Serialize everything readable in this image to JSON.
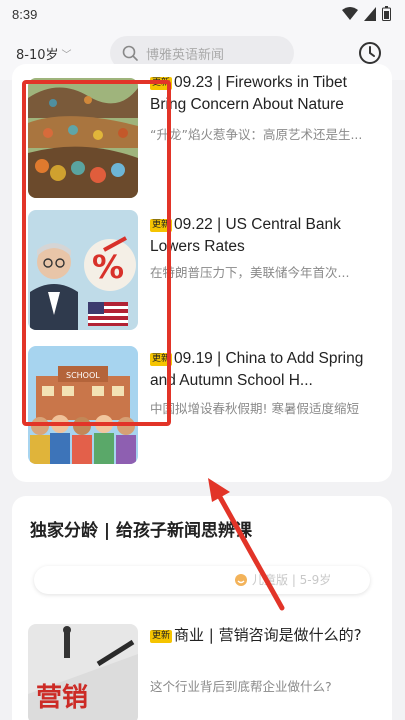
{
  "status_bar": {
    "time": "8:39"
  },
  "header": {
    "age_filter": "8-10岁",
    "search_placeholder": "博雅英语新闻"
  },
  "articles": [
    {
      "tag": "更新",
      "title": "09.23 | Fireworks in Tibet Bring Concern About Nature",
      "subtitle": "“升龙”焰火惹争议：高原艺术还是生..."
    },
    {
      "tag": "更新",
      "title": "09.22 | US Central Bank Lowers Rates",
      "subtitle": "在特朗普压力下，美联储今年首次..."
    },
    {
      "tag": "更新",
      "title": "09.19 | China to Add Spring and Autumn School H...",
      "subtitle": "中国拟增设春秋假期! 寒暑假适度缩短"
    }
  ],
  "section2": {
    "title": "独家分龄 | 给孩子新闻思辨课",
    "pill_label": "儿童版 | 5-9岁",
    "article": {
      "tag": "更新",
      "title": "商业 | 营销咨询是做什么的?",
      "subtitle": "这个行业背后到底帮企业做什么?",
      "thumb_text": "营销"
    }
  },
  "colors": {
    "annotation_red": "#e23428",
    "tag_yellow": "#f5c400"
  }
}
